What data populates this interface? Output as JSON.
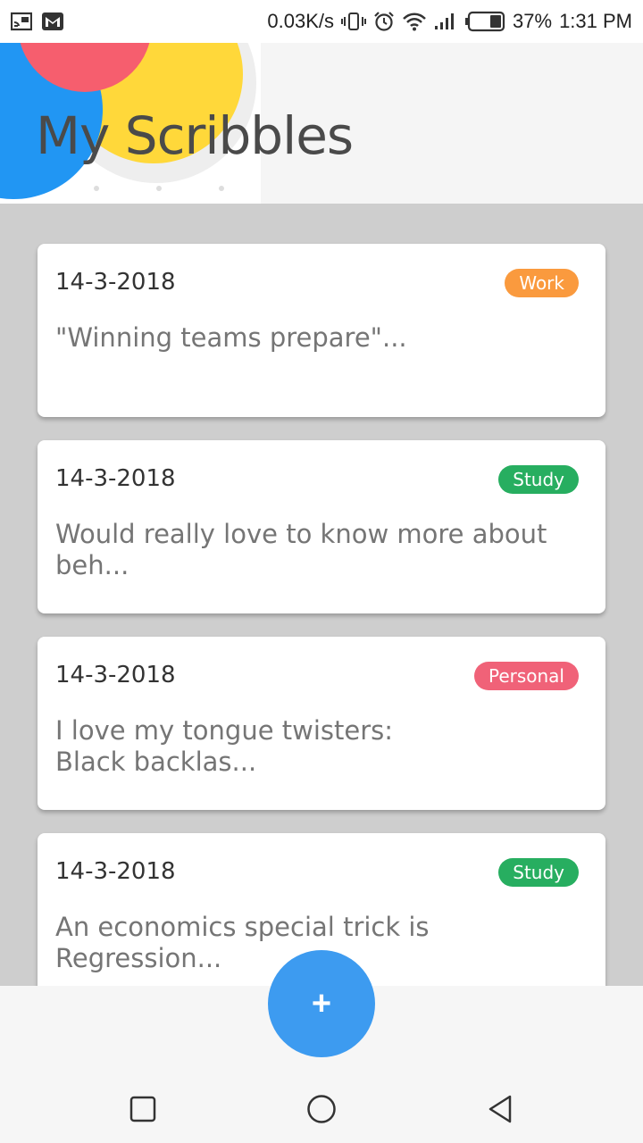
{
  "status_bar": {
    "left_icons": [
      "cast-icon",
      "gmail-icon"
    ],
    "network_speed": "0.03K/s",
    "battery_percent": "37%",
    "time": "1:31 PM",
    "right_icons": [
      "vibrate-icon",
      "alarm-icon",
      "wifi-icon",
      "signal-icon",
      "battery-icon"
    ]
  },
  "header": {
    "title": "My Scribbles"
  },
  "notes": [
    {
      "date": "14-3-2018",
      "tag": "Work",
      "tag_color": "#fa9a3e",
      "preview": "\"Winning teams prepare\"..."
    },
    {
      "date": "14-3-2018",
      "tag": "Study",
      "tag_color": "#27ae60",
      "preview": "Would really love to know more about beh..."
    },
    {
      "date": "14-3-2018",
      "tag": "Personal",
      "tag_color": "#f06278",
      "preview": "I love my tongue twisters:\nBlack backlas..."
    },
    {
      "date": "14-3-2018",
      "tag": "Study",
      "tag_color": "#27ae60",
      "preview": "An economics special trick is\nRegression..."
    }
  ],
  "fab": {
    "label": "+",
    "color": "#3d9bf0"
  },
  "nav_bar": {
    "icons": [
      "recent-apps-icon",
      "home-icon",
      "back-icon"
    ]
  }
}
